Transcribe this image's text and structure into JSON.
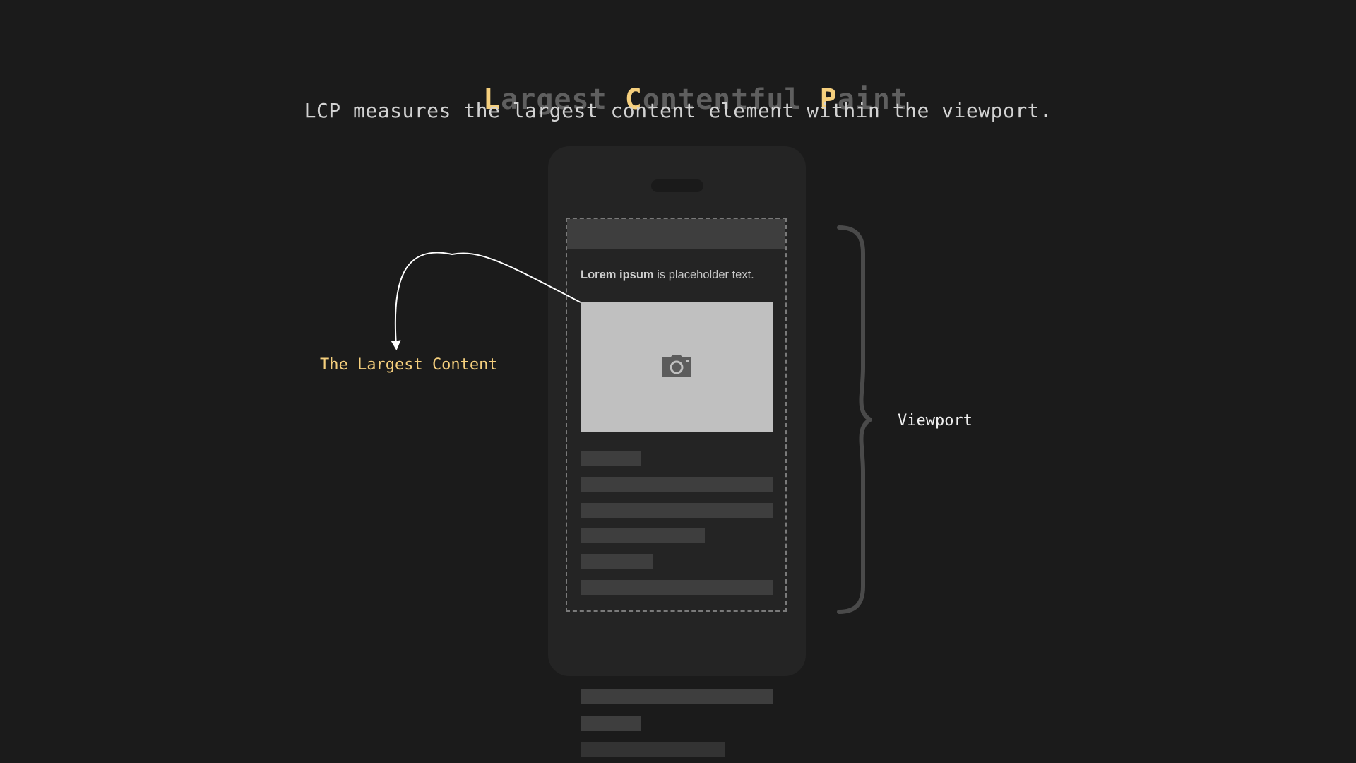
{
  "title": {
    "parts": [
      {
        "text": "L",
        "highlight": true
      },
      {
        "text": "argest ",
        "highlight": false
      },
      {
        "text": "C",
        "highlight": true
      },
      {
        "text": "ontentful ",
        "highlight": false
      },
      {
        "text": "P",
        "highlight": true
      },
      {
        "text": "aint",
        "highlight": false
      }
    ]
  },
  "subtitle": "LCP measures the largest content element within the viewport.",
  "phone": {
    "text_bold": "Lorem ipsum",
    "text_rest": " is placeholder text.",
    "image_icon": "camera-icon"
  },
  "annotations": {
    "largest_content_label": "The Largest Content",
    "viewport_label": "Viewport"
  },
  "colors": {
    "background": "#1b1b1b",
    "accent": "#f5cf7d",
    "title_dim": "#5f5f5f",
    "phone_body": "#242424",
    "placeholder_bar": "#3e3e3e",
    "image_placeholder": "#c0c0c0"
  }
}
